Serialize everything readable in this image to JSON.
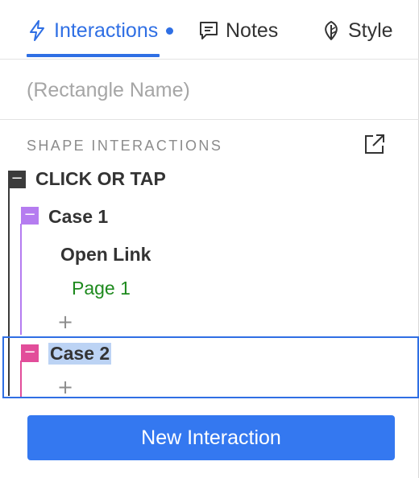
{
  "tabs": [
    {
      "label": "Interactions",
      "icon": "lightning-icon",
      "active": true,
      "indicator": "unsaved-dot"
    },
    {
      "label": "Notes",
      "icon": "speech-bubble-icon",
      "active": false
    },
    {
      "label": "Style",
      "icon": "leaf-icon",
      "active": false
    }
  ],
  "name_field": {
    "value": "",
    "placeholder": "(Rectangle Name)"
  },
  "section": {
    "title": "SHAPE INTERACTIONS",
    "popout_icon": "open-external-icon"
  },
  "tree": {
    "event": {
      "label": "CLICK OR TAP",
      "toggle": "−",
      "color": "#3b3b3b"
    },
    "cases": [
      {
        "label": "Case 1",
        "toggle": "−",
        "color": "#b57cf0",
        "actions": [
          {
            "label": "Open Link",
            "target": "Page 1",
            "target_color": "#1e8a1e"
          }
        ],
        "add_label": "+"
      },
      {
        "label": "Case 2",
        "toggle": "−",
        "color": "#e24d9a",
        "selected": true,
        "actions": [],
        "add_label": "+"
      }
    ]
  },
  "new_interaction_button": {
    "label": "New Interaction"
  },
  "colors": {
    "accent": "#2f6fe4",
    "button": "#3478f0",
    "selection_highlight": "#bcd3f4"
  }
}
